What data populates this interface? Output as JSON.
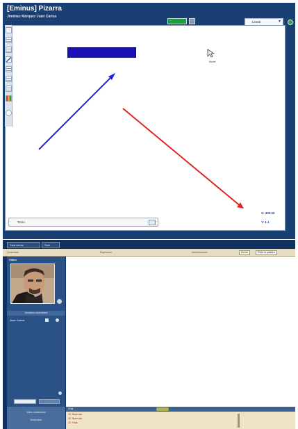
{
  "pizarra": {
    "title": "[Eminus] Pizarra",
    "user": "Jiménez Márquez Juan Carlos",
    "select_value": "Lineal",
    "input_placeholder": "Texto",
    "coord_x": "X: 400.00",
    "coord_y": "Y: 1.1",
    "cursor_label": "Mover",
    "colors": {
      "accent": "#1a3f73",
      "stroke_blue": "#2222dd",
      "stroke_red": "#e02424",
      "textbox": "#1c11b7"
    }
  },
  "conference": {
    "tabs": [
      "Sala virtual",
      "Salir"
    ],
    "bar_text_left": "Conectado",
    "bar_text_mid": "Esperando",
    "bar_text_right": "Intervenciones",
    "bar_button_1": "Enviar",
    "bar_button_2": "Pedir la palabra",
    "video_label": "Video",
    "participants_header": "Usuarios conectados",
    "participant_name": "Juan Carlos",
    "field_value": "",
    "side_button": "Escribir",
    "bottom_left_1": "Video conferencia",
    "bottom_left_2": "Moderador",
    "chat_header": "Chat",
    "chat_lines": [
      "JC: Buen día",
      "JC: Buen día",
      "JC: Hola"
    ]
  }
}
